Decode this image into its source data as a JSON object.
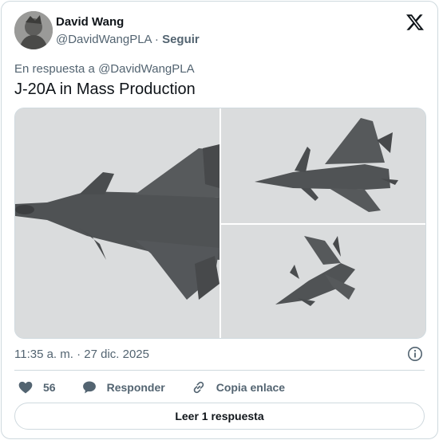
{
  "author": {
    "name": "David Wang",
    "handle": "@DavidWangPLA",
    "separator": " · ",
    "follow_label": "Seguir"
  },
  "reply_context": "En respuesta a @DavidWangPLA",
  "tweet_text": "J-20A in Mass Production",
  "media": {
    "photos": [
      {
        "icon": "fighter-jet-closeup-photo"
      },
      {
        "icon": "fighter-jet-flying-photo"
      },
      {
        "icon": "fighter-jet-banking-photo"
      }
    ]
  },
  "timestamp": "11:35 a. m. · 27 dic. 2025",
  "actions": {
    "like_count": "56",
    "reply_label": "Responder",
    "copy_link_label": "Copia enlace"
  },
  "read_replies_label": "Leer 1 respuesta",
  "colors": {
    "text_primary": "#0f1419",
    "text_secondary": "#536471",
    "border": "#cfd9de"
  }
}
